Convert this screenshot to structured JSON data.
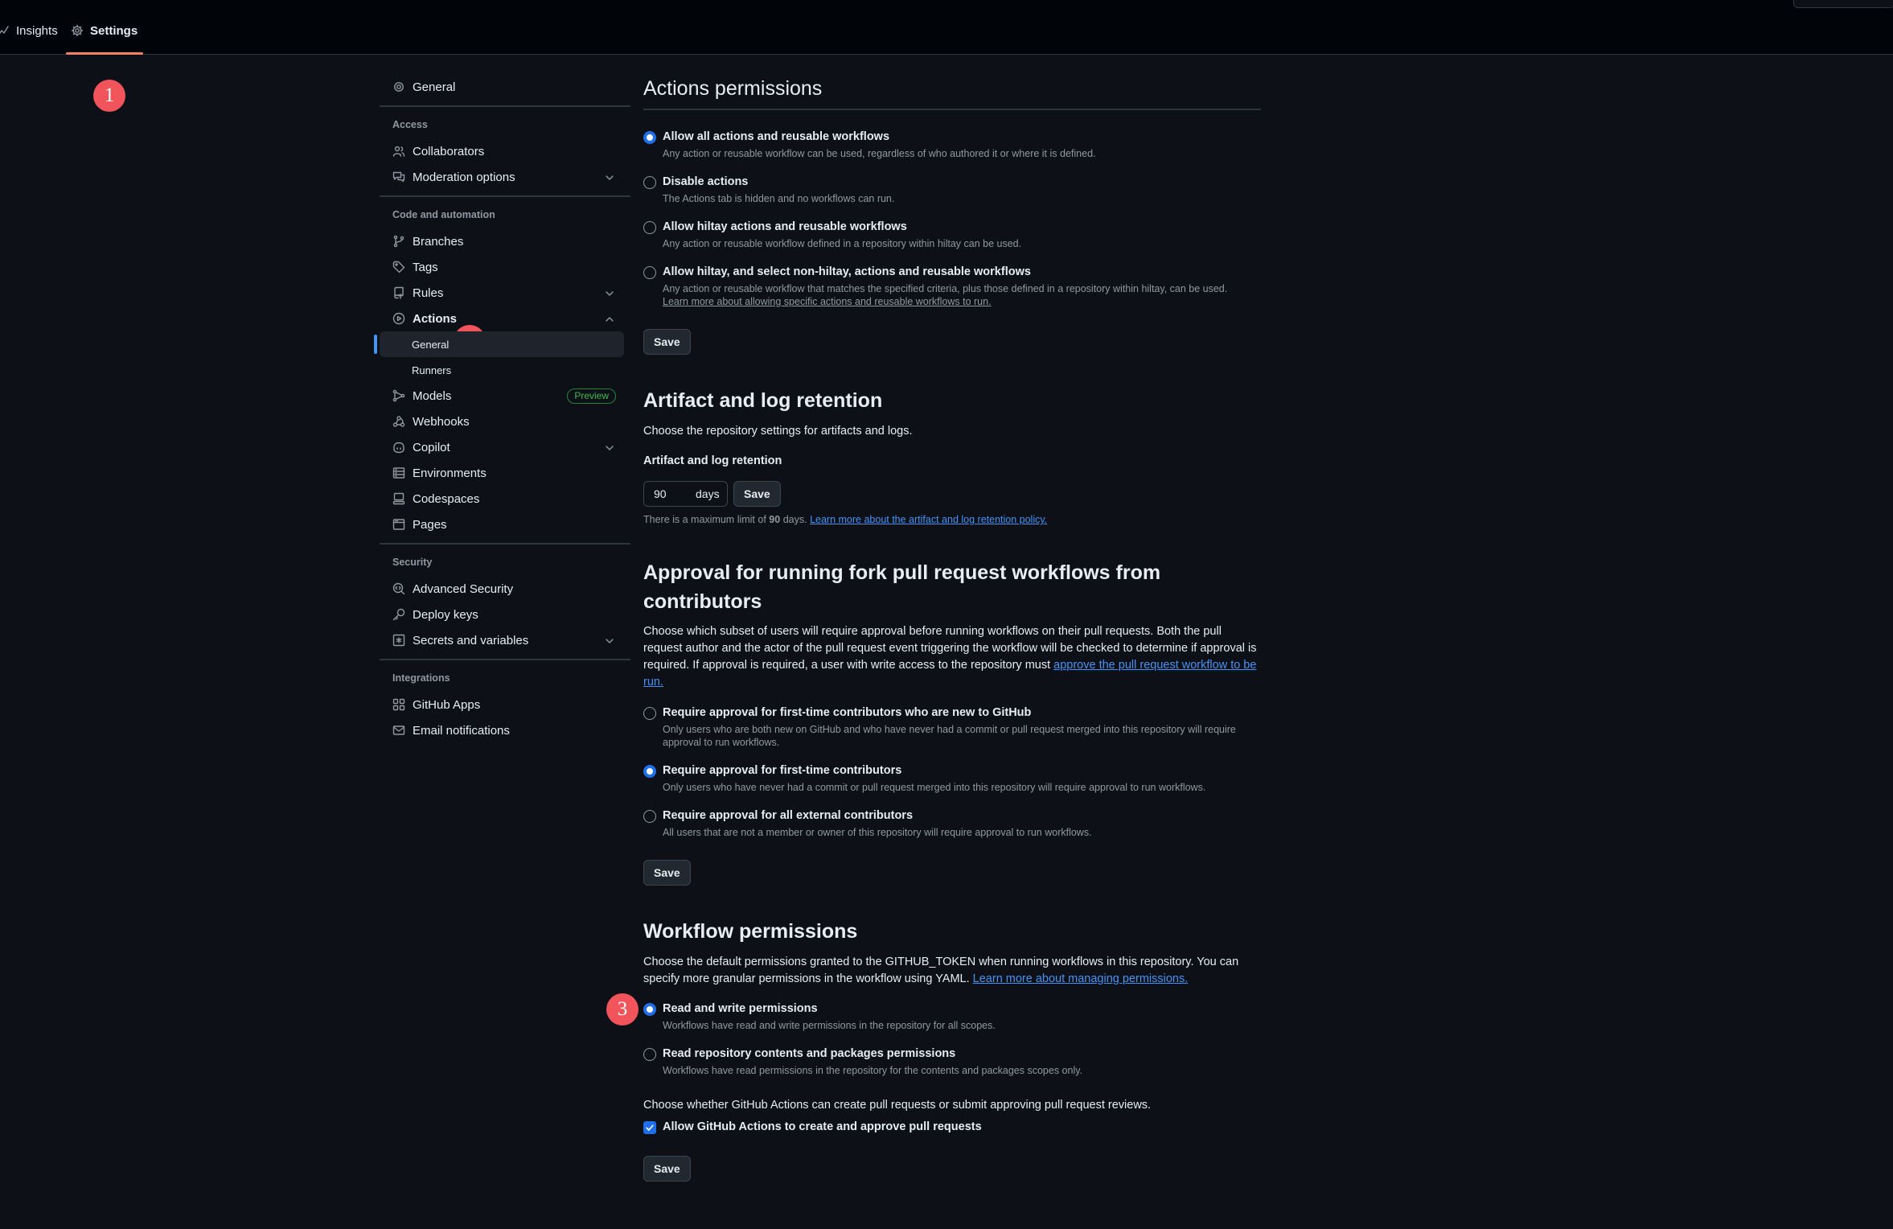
{
  "topbar": {
    "tabs": [
      {
        "label": "Insights",
        "icon": "graph-icon"
      },
      {
        "label": "Settings",
        "icon": "gear-icon"
      }
    ]
  },
  "annotations": [
    "1",
    "2",
    "3"
  ],
  "sidebar": {
    "general": "General",
    "sections": {
      "access": "Access",
      "code": "Code and automation",
      "security": "Security",
      "integrations": "Integrations"
    },
    "items": {
      "collaborators": "Collaborators",
      "moderation": "Moderation options",
      "branches": "Branches",
      "tags": "Tags",
      "rules": "Rules",
      "actions": "Actions",
      "actions_general": "General",
      "actions_runners": "Runners",
      "models": "Models",
      "models_badge": "Preview",
      "webhooks": "Webhooks",
      "copilot": "Copilot",
      "environments": "Environments",
      "codespaces": "Codespaces",
      "pages": "Pages",
      "advanced_security": "Advanced Security",
      "deploy_keys": "Deploy keys",
      "secrets": "Secrets and variables",
      "github_apps": "GitHub Apps",
      "email_notifications": "Email notifications"
    }
  },
  "actions_permissions": {
    "title": "Actions permissions",
    "options": [
      {
        "title": "Allow all actions and reusable workflows",
        "desc": "Any action or reusable workflow can be used, regardless of who authored it or where it is defined.",
        "selected": true
      },
      {
        "title": "Disable actions",
        "desc": "The Actions tab is hidden and no workflows can run.",
        "selected": false
      },
      {
        "title": "Allow hiltay actions and reusable workflows",
        "desc": "Any action or reusable workflow defined in a repository within hiltay can be used.",
        "selected": false
      },
      {
        "title": "Allow hiltay, and select non-hiltay, actions and reusable workflows",
        "desc": "Any action or reusable workflow that matches the specified criteria, plus those defined in a repository within hiltay, can be used.",
        "selected": false
      }
    ],
    "learn_more": "Learn more about allowing specific actions and reusable workflows to run.",
    "save": "Save"
  },
  "artifact": {
    "title": "Artifact and log retention",
    "desc": "Choose the repository settings for artifacts and logs.",
    "label": "Artifact and log retention",
    "value": "90",
    "unit": "days",
    "save": "Save",
    "note_prefix": "There is a maximum limit of",
    "note_limit": "90",
    "note_suffix": "days.",
    "note_link": "Learn more about the artifact and log retention policy."
  },
  "approval": {
    "title": "Approval for running fork pull request workflows from contributors",
    "desc": "Choose which subset of users will require approval before running workflows on their pull requests. Both the pull request author and the actor of the pull request event triggering the workflow will be checked to determine if approval is required. If approval is required, a user with write access to the repository must",
    "desc_link": "approve the pull request workflow to be run.",
    "options": [
      {
        "title": "Require approval for first-time contributors who are new to GitHub",
        "desc": "Only users who are both new on GitHub and who have never had a commit or pull request merged into this repository will require approval to run workflows.",
        "selected": false
      },
      {
        "title": "Require approval for first-time contributors",
        "desc": "Only users who have never had a commit or pull request merged into this repository will require approval to run workflows.",
        "selected": true
      },
      {
        "title": "Require approval for all external contributors",
        "desc": "All users that are not a member or owner of this repository will require approval to run workflows.",
        "selected": false
      }
    ],
    "save": "Save"
  },
  "workflow": {
    "title": "Workflow permissions",
    "desc": "Choose the default permissions granted to the GITHUB_TOKEN when running workflows in this repository. You can specify more granular permissions in the workflow using YAML.",
    "desc_link": "Learn more about managing permissions.",
    "options": [
      {
        "title": "Read and write permissions",
        "desc": "Workflows have read and write permissions in the repository for all scopes.",
        "selected": true
      },
      {
        "title": "Read repository contents and packages permissions",
        "desc": "Workflows have read permissions in the repository for the contents and packages scopes only.",
        "selected": false
      }
    ],
    "pr_desc": "Choose whether GitHub Actions can create pull requests or submit approving pull request reviews.",
    "checkbox_label": "Allow GitHub Actions to create and approve pull requests",
    "checkbox_checked": true,
    "save": "Save"
  }
}
